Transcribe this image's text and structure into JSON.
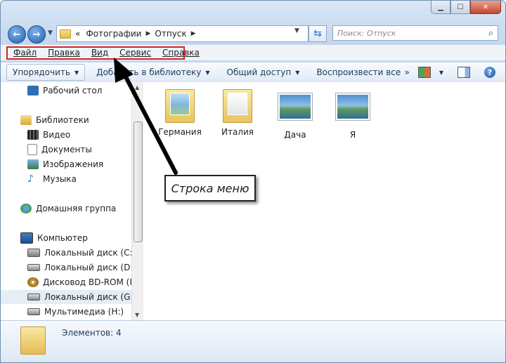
{
  "window": {
    "caption": {
      "min_icon": "minimize-icon",
      "max_icon": "maximize-icon",
      "close_icon": "close-icon"
    }
  },
  "address_bar": {
    "prefix": "«",
    "segments": [
      "Фотографии",
      "Отпуск"
    ],
    "search_placeholder": "Поиск: Отпуск"
  },
  "menu_bar": {
    "items": [
      "Файл",
      "Правка",
      "Вид",
      "Сервис",
      "Справка"
    ]
  },
  "toolbar": {
    "organize": "Упорядочить",
    "add_to_library": "Добавить в библиотеку",
    "share": "Общий доступ",
    "play_all": "Воспроизвести все",
    "more": "»"
  },
  "nav_pane": {
    "items": [
      {
        "label": "Рабочий стол",
        "icon": "desktop-icon"
      },
      {
        "label": "Библиотеки",
        "icon": "libraries-icon"
      },
      {
        "label": "Видео",
        "icon": "video-icon"
      },
      {
        "label": "Документы",
        "icon": "documents-icon"
      },
      {
        "label": "Изображения",
        "icon": "pictures-icon"
      },
      {
        "label": "Музыка",
        "icon": "music-icon"
      },
      {
        "label": "Домашняя группа",
        "icon": "homegroup-icon"
      },
      {
        "label": "Компьютер",
        "icon": "computer-icon"
      },
      {
        "label": "Локальный диск (C:)",
        "icon": "system-drive-icon"
      },
      {
        "label": "Локальный диск (D:)",
        "icon": "drive-icon"
      },
      {
        "label": "Дисковод BD-ROM (F:)",
        "icon": "optical-drive-icon"
      },
      {
        "label": "Локальный диск (G:)",
        "icon": "drive-icon",
        "selected": true
      },
      {
        "label": "Мультимедиа (H:)",
        "icon": "drive-icon"
      }
    ]
  },
  "content": {
    "items": [
      {
        "label": "Германия",
        "type": "folder"
      },
      {
        "label": "Италия",
        "type": "folder"
      },
      {
        "label": "Дача",
        "type": "image"
      },
      {
        "label": "Я",
        "type": "image"
      }
    ]
  },
  "annotation": {
    "callout_text": "Строка меню",
    "highlight_color": "#d22222"
  },
  "details_pane": {
    "count_text": "Элементов: 4"
  }
}
